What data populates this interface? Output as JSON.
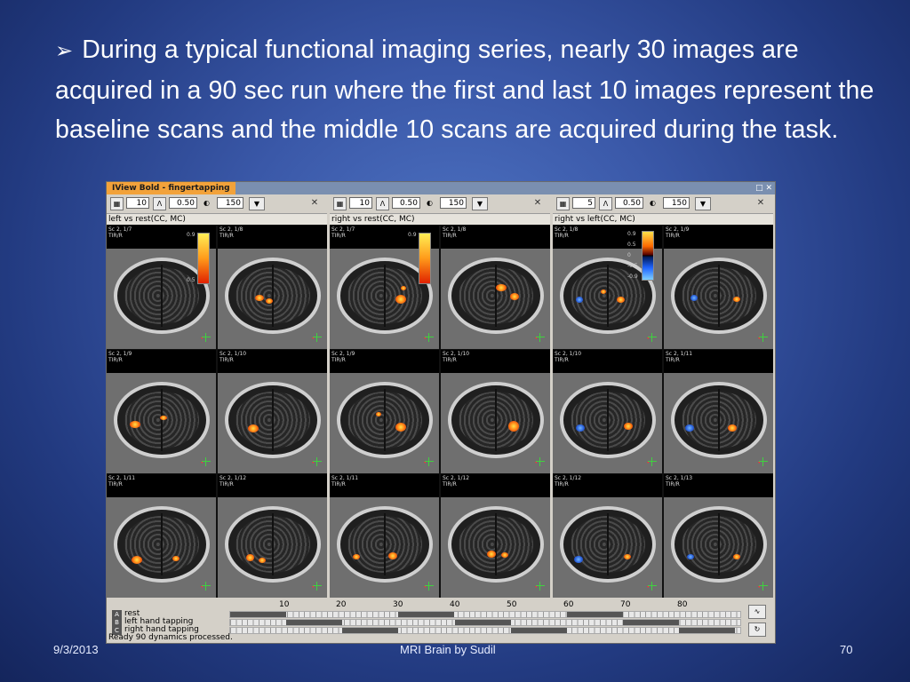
{
  "slide": {
    "bullet_text": "During a typical functional imaging series, nearly 30 images are acquired in a 90 sec run where the first and last 10 images represent the baseline scans and the middle 10 scans are acquired during the task.",
    "footer_date": "9/3/2013",
    "footer_title": "MRI Brain by Sudil",
    "footer_page": "70"
  },
  "app": {
    "title": "IView Bold - fingertapping",
    "panels": [
      {
        "label": "left vs rest(CC, MC)",
        "field1": "10",
        "field2": "0.50",
        "field3": "150",
        "cells": [
          "Sc 2, 1/7",
          "Sc 2, 1/8",
          "Sc 2, 1/9",
          "Sc 2, 1/10",
          "Sc 2, 1/11",
          "Sc 2, 1/12"
        ],
        "scale_top": "0.9",
        "scale_bottom": "0.5"
      },
      {
        "label": "right vs rest(CC, MC)",
        "field1": "10",
        "field2": "0.50",
        "field3": "150",
        "cells": [
          "Sc 2, 1/7",
          "Sc 2, 1/8",
          "Sc 2, 1/9",
          "Sc 2, 1/10",
          "Sc 2, 1/11",
          "Sc 2, 1/12"
        ],
        "scale_top": "0.9",
        "scale_bottom": ""
      },
      {
        "label": "right vs left(CC, MC)",
        "field1": "5",
        "field2": "0.50",
        "field3": "150",
        "cells": [
          "Sc 2, 1/8",
          "Sc 2, 1/9",
          "Sc 2, 1/10",
          "Sc 2, 1/11",
          "Sc 2, 1/12",
          "Sc 2, 1/13"
        ],
        "scale_labels": [
          "0.9",
          "0.5",
          "0",
          "-0.5",
          "-0.9"
        ]
      }
    ],
    "cell_sublabel": "TIR/R",
    "timeline": {
      "ticks": [
        "10",
        "20",
        "30",
        "40",
        "50",
        "60",
        "70",
        "80"
      ],
      "rows": [
        {
          "key": "A",
          "name": "rest"
        },
        {
          "key": "B",
          "name": "left hand tapping"
        },
        {
          "key": "C",
          "name": "right hand tapping"
        }
      ]
    },
    "status": "Ready  90 dynamics processed."
  }
}
